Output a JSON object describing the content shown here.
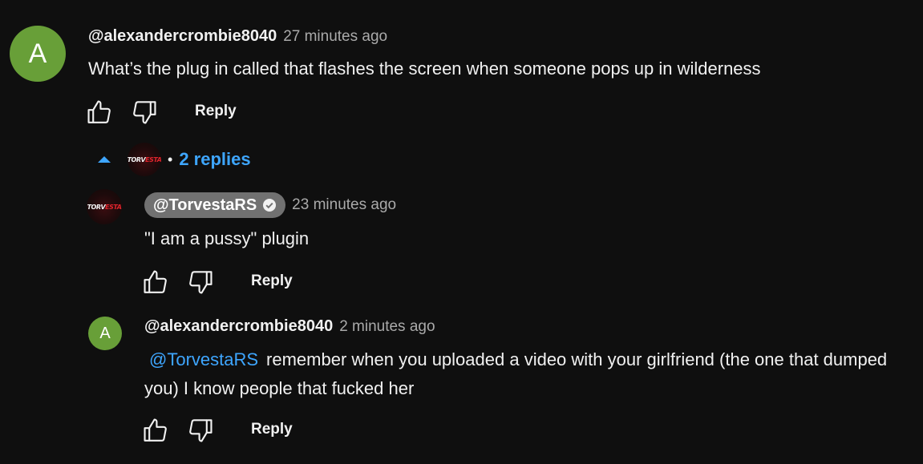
{
  "comment": {
    "avatar_letter": "A",
    "author": "@alexandercrombie8040",
    "time": "27 minutes ago",
    "text": "What’s the plug in called that flashes the screen when someone pops up in wilderness",
    "reply_label": "Reply"
  },
  "replies_toggle": {
    "separator": "•",
    "label": "2 replies"
  },
  "channel_logo": {
    "part1": "TORV",
    "part2": "ESTA"
  },
  "replies": [
    {
      "author": "@TorvestaRS",
      "time": "23 minutes ago",
      "text": "\"I am a pussy\" plugin",
      "reply_label": "Reply"
    },
    {
      "avatar_letter": "A",
      "author": "@alexandercrombie8040",
      "time": "2 minutes ago",
      "mention": "@TorvestaRS",
      "text": "remember when you uploaded a video with your girlfriend (the one that dumped you) I know people that fucked her",
      "reply_label": "Reply"
    }
  ],
  "colors": {
    "background": "#0f0f0f",
    "text": "#f1f1f1",
    "secondary_text": "#aaaaaa",
    "link_blue": "#3ea6ff",
    "avatar_green": "#689f38",
    "verified_chip": "#717171"
  }
}
